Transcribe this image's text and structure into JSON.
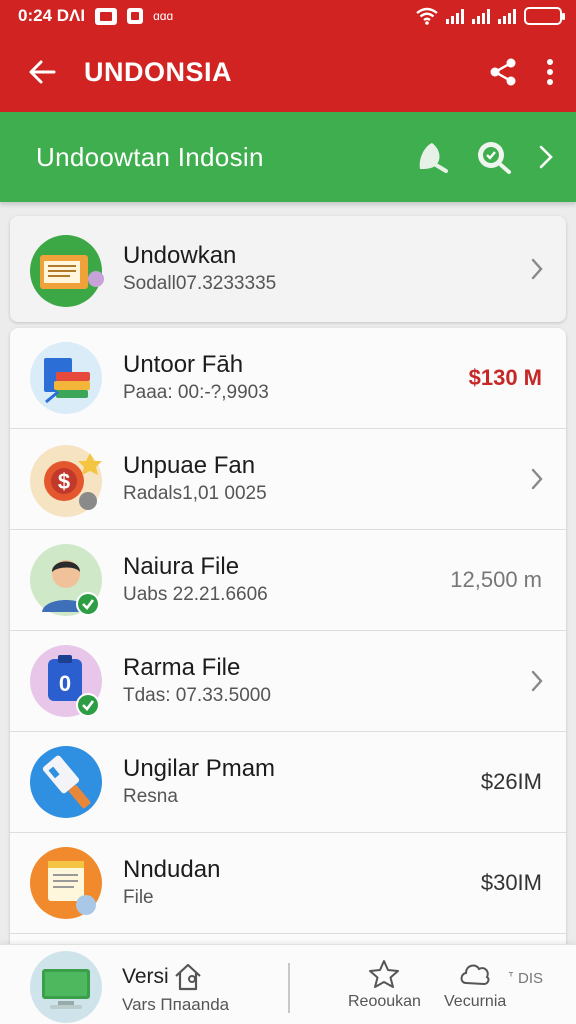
{
  "status_bar": {
    "time": "0:24 DΛI",
    "tiny": "ɑɑɑ"
  },
  "app_bar": {
    "title": "UNDONSIA"
  },
  "sub_bar": {
    "title": "Undoowtan Indosin"
  },
  "featured": {
    "title": "Undowkan",
    "subtitle": "Sodall07.3233335"
  },
  "rows": [
    {
      "title": "Untoor Fāh",
      "subtitle": "Paaa: 00:-?,9903",
      "trailing": "$130 M"
    },
    {
      "title": "Unpuae Fan",
      "subtitle": "Radals1,01  0025"
    },
    {
      "title": "Naiura File",
      "subtitle": "Uabs 22.21.6606",
      "trailing": "12,500 m"
    },
    {
      "title": "Rarma File",
      "subtitle": "Tdas: 07.33.5000"
    },
    {
      "title": "Ungilar Pmam",
      "subtitle": "Resna",
      "trailing": "$26IM"
    },
    {
      "title": "Nndudan",
      "subtitle": "File",
      "trailing": "$30IM"
    }
  ],
  "bottom_bar": {
    "title": "Versi",
    "subtitle": "Vars Ппаanda",
    "tab1_label": "Reooukan",
    "tab2_label": "Vecurnia",
    "extra": "ᐪ DIS"
  },
  "colors": {
    "primary_red": "#d12322",
    "primary_green": "#3fae4e"
  },
  "icons": [
    "back-arrow-icon",
    "share-icon",
    "more-vert-icon",
    "leaf-icon",
    "search-check-icon",
    "chevron-right-icon",
    "home-icon",
    "star-icon",
    "cloud-icon"
  ]
}
